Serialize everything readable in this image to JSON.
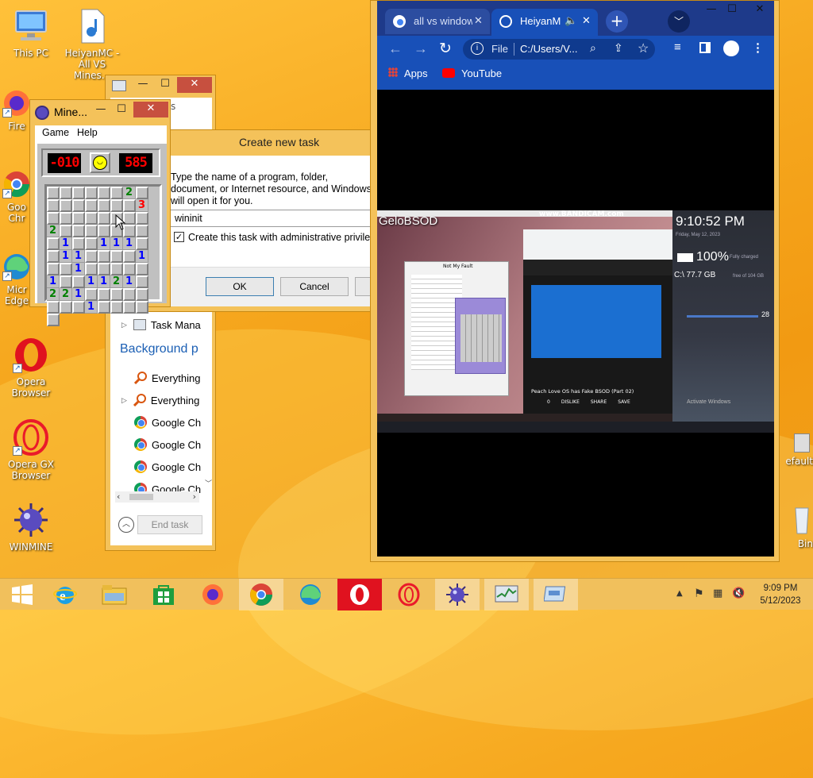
{
  "desktop": {
    "icons": [
      {
        "label": "This PC",
        "icon": "computer-icon"
      },
      {
        "label": "HeiyanMC - All VS Mines...",
        "icon": "media-file-icon"
      },
      {
        "label": "Fire",
        "icon": "firefox-icon"
      },
      {
        "label": "Goo Chr",
        "icon": "chrome-icon"
      },
      {
        "label": "Micr Edge",
        "icon": "edge-icon"
      },
      {
        "label": "Opera Browser",
        "icon": "opera-icon"
      },
      {
        "label": "Opera GX Browser",
        "icon": "opera-gx-icon"
      },
      {
        "label": "WINMINE",
        "icon": "mine-icon"
      },
      {
        "label": "efault",
        "icon": "generic-icon"
      },
      {
        "label": "Bin",
        "icon": "recycle-bin-icon"
      }
    ]
  },
  "minesweeper": {
    "title": "Mine...",
    "menu": [
      "Game",
      "Help"
    ],
    "mine_counter": "-010",
    "timer": "585",
    "grid": [
      [
        "u",
        "u",
        "u",
        "u",
        "u",
        "u",
        "2",
        "u",
        "u"
      ],
      [
        "u",
        "u",
        "u",
        "u",
        "u",
        "u",
        "3",
        "u",
        "u"
      ],
      [
        "u",
        "u",
        "u",
        "u",
        "u",
        "u",
        "2",
        "u",
        "u"
      ],
      [
        "u",
        "u",
        "u",
        "u",
        "u",
        "u",
        "1",
        "u",
        "u"
      ],
      [
        "1",
        "1",
        "1",
        "u",
        "u",
        "1",
        "1",
        "u",
        "u"
      ],
      [
        "u",
        "u",
        "1",
        "u",
        "u",
        "1",
        "u",
        "u",
        "u"
      ],
      [
        "u",
        "u",
        "1",
        "u",
        "u",
        "1",
        "1",
        "2",
        "1"
      ],
      [
        "u",
        "2",
        "2",
        "1",
        "u",
        "u",
        "u",
        "u",
        "u"
      ],
      [
        "u",
        "u",
        "u",
        "1",
        "u",
        "u",
        "u",
        "u",
        "u"
      ]
    ],
    "num_colors": {
      "1": "#0000ff",
      "2": "#008000",
      "3": "#ff0000"
    }
  },
  "create_task": {
    "title": "Create new task",
    "desc": "Type the name of a program, folder, document, or Internet resource, and Windows will open it for you.",
    "open_value": "wininit",
    "admin_label": "Create this task with administrative privileges.",
    "ok": "OK",
    "cancel": "Cancel"
  },
  "task_manager": {
    "app_row": "Task Mana",
    "section": "Background p",
    "rows": [
      "Everything",
      "Everything",
      "Google Ch",
      "Google Ch",
      "Google Ch",
      "Google Ch"
    ],
    "end_task": "End task",
    "partial_text": "s"
  },
  "browser": {
    "tabs": [
      {
        "title": "all vs window",
        "active": false
      },
      {
        "title": "HeiyanM",
        "active": true
      }
    ],
    "address_prefix": "File",
    "address": "C:/Users/V...",
    "bookmarks": [
      "Apps",
      "YouTube"
    ],
    "video": {
      "watermark": "www.BANDICAM.com",
      "overlay_title": "GeloBSOD",
      "clock": "9:10:52 PM",
      "date_small": "Friday, May 12, 2023",
      "battery": "100%",
      "battery_status": "Fully charged",
      "disk": "C:\\ 77.7 GB",
      "disk_free": "free of 104 GB",
      "volume": "28",
      "yt_title": "Peach Love OS has Fake BSOD (Part 02)",
      "yt_actions": [
        "0",
        "DISLIKE",
        "SHARE",
        "SAVE"
      ],
      "activate": "Activate Windows",
      "nmf_title": "Not My Fault"
    }
  },
  "taskbar": {
    "clock_time": "9:09 PM",
    "clock_date": "5/12/2023"
  }
}
